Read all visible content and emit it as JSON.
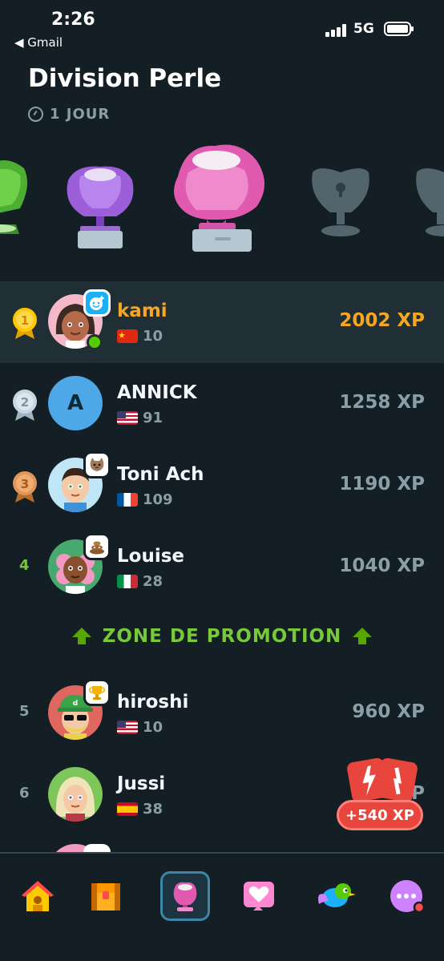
{
  "status_bar": {
    "time": "2:26",
    "back_label": "◀ Gmail",
    "network": "5G"
  },
  "header": {
    "title": "Division Perle",
    "timer": "1 JOUR"
  },
  "leaderboard": [
    {
      "rank": "1",
      "name": "kami",
      "streak": "10",
      "flag": "china",
      "xp": "2002 XP",
      "badge": "smiley-plus"
    },
    {
      "rank": "2",
      "name": "ANNICK",
      "initial": "A",
      "streak": "91",
      "flag": "usa",
      "xp": "1258 XP"
    },
    {
      "rank": "3",
      "name": "Toni Ach",
      "streak": "109",
      "flag": "france",
      "xp": "1190 XP",
      "badge": "cat"
    },
    {
      "rank": "4",
      "name": "Louise",
      "streak": "28",
      "flag": "italy",
      "xp": "1040 XP",
      "badge": "poop"
    },
    {
      "rank": "5",
      "name": "hiroshi",
      "streak": "10",
      "flag": "usa",
      "xp": "960 XP",
      "badge": "trophy"
    },
    {
      "rank": "6",
      "name": "Jussi",
      "streak": "38",
      "flag": "spain",
      "xp": "P"
    }
  ],
  "promotion_zone": {
    "label": "ZONE DE PROMOTION"
  },
  "xp_boost": {
    "label": "+540 XP"
  },
  "colors": {
    "gold_text": "#f5a623",
    "green": "#78c83c",
    "grey_text": "#8a9ea7"
  },
  "nav": [
    "home-icon",
    "treasure-chest-icon",
    "leagues-icon",
    "hearts-icon",
    "bird-icon",
    "more-icon"
  ]
}
